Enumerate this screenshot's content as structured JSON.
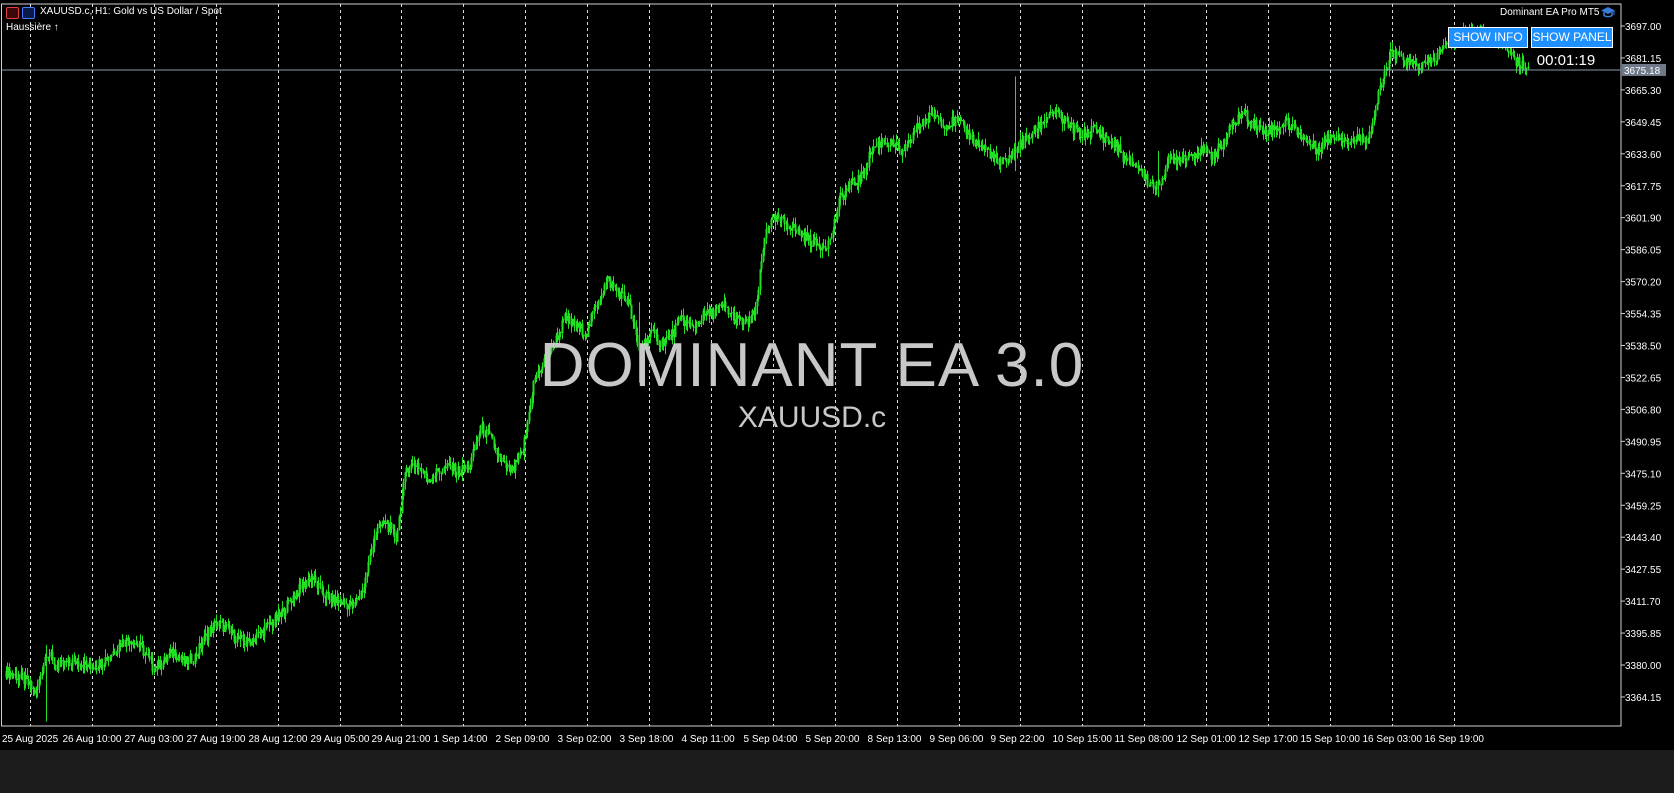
{
  "header": {
    "symbol_info": "XAUUSD.c, H1:  Gold vs US Dollar / Spot",
    "trend_label": "Haussière ↑",
    "ea_name": "Dominant EA Pro MT5",
    "ea_icon": "graduation-cap-icon"
  },
  "panel": {
    "show_info_label": "SHOW INFO",
    "show_panel_label": "SHOW PANEL",
    "timer": "00:01:19"
  },
  "watermark": {
    "title": "DOMINANT EA 3.0",
    "symbol": "XAUUSD.c"
  },
  "price_axis": {
    "labels": [
      "3697.00",
      "3681.15",
      "3665.30",
      "3649.45",
      "3633.60",
      "3617.75",
      "3601.90",
      "3586.05",
      "3570.20",
      "3554.35",
      "3538.50",
      "3522.65",
      "3506.80",
      "3490.95",
      "3475.10",
      "3459.25",
      "3443.40",
      "3427.55",
      "3411.70",
      "3395.85",
      "3380.00",
      "3364.15"
    ],
    "current_price": "3675.18"
  },
  "time_axis": {
    "labels": [
      "25 Aug 2025",
      "26 Aug 10:00",
      "27 Aug 03:00",
      "27 Aug 19:00",
      "28 Aug 12:00",
      "29 Aug 05:00",
      "29 Aug 21:00",
      "1 Sep 14:00",
      "2 Sep 09:00",
      "3 Sep 02:00",
      "3 Sep 18:00",
      "4 Sep 11:00",
      "5 Sep 04:00",
      "5 Sep 20:00",
      "8 Sep 13:00",
      "9 Sep 06:00",
      "9 Sep 22:00",
      "10 Sep 15:00",
      "11 Sep 08:00",
      "12 Sep 01:00",
      "12 Sep 17:00",
      "15 Sep 10:00",
      "16 Sep 03:00",
      "16 Sep 19:00"
    ]
  },
  "chart_data": {
    "type": "line",
    "series_path": [
      [
        0,
        3377
      ],
      [
        1,
        3375
      ],
      [
        2,
        3372
      ],
      [
        3,
        3366
      ],
      [
        4,
        3387
      ],
      [
        5,
        3379
      ],
      [
        6,
        3381
      ],
      [
        7,
        3382
      ],
      [
        8,
        3379
      ],
      [
        9,
        3381
      ],
      [
        10,
        3385
      ],
      [
        11,
        3391
      ],
      [
        12,
        3393
      ],
      [
        13,
        3388
      ],
      [
        14,
        3379
      ],
      [
        15,
        3381
      ],
      [
        16,
        3387
      ],
      [
        17,
        3381
      ],
      [
        18,
        3384
      ],
      [
        19,
        3394
      ],
      [
        20,
        3401
      ],
      [
        21,
        3398
      ],
      [
        22,
        3393
      ],
      [
        23,
        3391
      ],
      [
        24,
        3395
      ],
      [
        25,
        3400
      ],
      [
        26,
        3404
      ],
      [
        27,
        3412
      ],
      [
        28,
        3418
      ],
      [
        29,
        3424
      ],
      [
        30,
        3416
      ],
      [
        31,
        3412
      ],
      [
        32,
        3411
      ],
      [
        33,
        3409
      ],
      [
        34,
        3419
      ],
      [
        35,
        3445
      ],
      [
        36,
        3451
      ],
      [
        37,
        3443
      ],
      [
        38,
        3478
      ],
      [
        39,
        3480
      ],
      [
        40,
        3472
      ],
      [
        41,
        3476
      ],
      [
        42,
        3478
      ],
      [
        43,
        3476
      ],
      [
        44,
        3479
      ],
      [
        45,
        3498
      ],
      [
        46,
        3492
      ],
      [
        47,
        3480
      ],
      [
        48,
        3476
      ],
      [
        49,
        3486
      ],
      [
        50,
        3520
      ],
      [
        51,
        3530
      ],
      [
        52,
        3540
      ],
      [
        53,
        3552
      ],
      [
        54,
        3548
      ],
      [
        55,
        3545
      ],
      [
        56,
        3560
      ],
      [
        57,
        3571
      ],
      [
        58,
        3565
      ],
      [
        59,
        3560
      ],
      [
        60,
        3535
      ],
      [
        61,
        3545
      ],
      [
        62,
        3540
      ],
      [
        63,
        3543
      ],
      [
        64,
        3552
      ],
      [
        65,
        3547
      ],
      [
        66,
        3553
      ],
      [
        67,
        3555
      ],
      [
        68,
        3558
      ],
      [
        69,
        3552
      ],
      [
        70,
        3549
      ],
      [
        71,
        3555
      ],
      [
        72,
        3598
      ],
      [
        73,
        3601
      ],
      [
        74,
        3599
      ],
      [
        75,
        3595
      ],
      [
        76,
        3591
      ],
      [
        77,
        3588
      ],
      [
        78,
        3590
      ],
      [
        79,
        3612
      ],
      [
        80,
        3618
      ],
      [
        81,
        3622
      ],
      [
        82,
        3636
      ],
      [
        83,
        3640
      ],
      [
        84,
        3638
      ],
      [
        85,
        3633
      ],
      [
        86,
        3645
      ],
      [
        87,
        3650
      ],
      [
        88,
        3653
      ],
      [
        89,
        3648
      ],
      [
        90,
        3650
      ],
      [
        91,
        3644
      ],
      [
        92,
        3638
      ],
      [
        93,
        3635
      ],
      [
        94,
        3628
      ],
      [
        95,
        3632
      ],
      [
        96,
        3638
      ],
      [
        97,
        3643
      ],
      [
        98,
        3649
      ],
      [
        99,
        3655
      ],
      [
        100,
        3650
      ],
      [
        101,
        3646
      ],
      [
        102,
        3643
      ],
      [
        103,
        3646
      ],
      [
        104,
        3641
      ],
      [
        105,
        3638
      ],
      [
        106,
        3630
      ],
      [
        107,
        3628
      ],
      [
        108,
        3620
      ],
      [
        109,
        3617
      ],
      [
        110,
        3630
      ],
      [
        111,
        3632
      ],
      [
        112,
        3633
      ],
      [
        113,
        3635
      ],
      [
        114,
        3633
      ],
      [
        115,
        3637
      ],
      [
        116,
        3648
      ],
      [
        117,
        3654
      ],
      [
        118,
        3649
      ],
      [
        119,
        3645
      ],
      [
        120,
        3646
      ],
      [
        121,
        3649
      ],
      [
        122,
        3646
      ],
      [
        123,
        3640
      ],
      [
        124,
        3636
      ],
      [
        125,
        3641
      ],
      [
        126,
        3643
      ],
      [
        127,
        3640
      ],
      [
        128,
        3641
      ],
      [
        129,
        3643
      ],
      [
        130,
        3665
      ],
      [
        131,
        3683
      ],
      [
        132,
        3681
      ],
      [
        133,
        3678
      ],
      [
        134,
        3677
      ],
      [
        135,
        3680
      ],
      [
        136,
        3686
      ],
      [
        137,
        3690
      ],
      [
        138,
        3693
      ],
      [
        139,
        3695
      ],
      [
        140,
        3693
      ],
      [
        141,
        3690
      ],
      [
        142,
        3687
      ],
      [
        143,
        3679
      ],
      [
        144,
        3677
      ]
    ],
    "ylim": [
      3355,
      3703
    ]
  }
}
